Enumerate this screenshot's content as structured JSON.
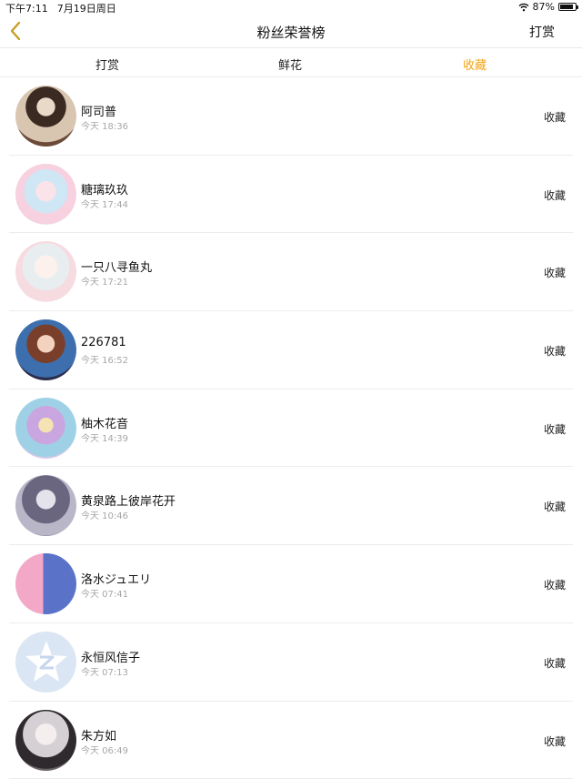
{
  "status_bar": {
    "time": "下午7:11",
    "date": "7月19日周日",
    "battery_text": "87%",
    "battery_level": 0.87
  },
  "nav": {
    "title": "粉丝荣誉榜",
    "right_label": "打赏",
    "accent_color": "#f2a413"
  },
  "tabs": [
    {
      "label": "打赏",
      "active": false
    },
    {
      "label": "鲜花",
      "active": false
    },
    {
      "label": "收藏",
      "active": true
    }
  ],
  "list": [
    {
      "name": "阿司普",
      "time": "今天 18:36",
      "action": "收藏"
    },
    {
      "name": "糖璃玖玖",
      "time": "今天 17:44",
      "action": "收藏"
    },
    {
      "name": "一只八寻鱼丸",
      "time": "今天 17:21",
      "action": "收藏"
    },
    {
      "name": "226781",
      "time": "今天 16:52",
      "action": "收藏"
    },
    {
      "name": "柚木花音",
      "time": "今天 14:39",
      "action": "收藏"
    },
    {
      "name": "黄泉路上彼岸花开",
      "time": "今天 10:46",
      "action": "收藏"
    },
    {
      "name": "洛水ジュエリ",
      "time": "今天 07:41",
      "action": "收藏"
    },
    {
      "name": "永恒风信子",
      "time": "今天 07:13",
      "action": "收藏"
    },
    {
      "name": "朱方如",
      "time": "今天 06:49",
      "action": "收藏"
    }
  ]
}
